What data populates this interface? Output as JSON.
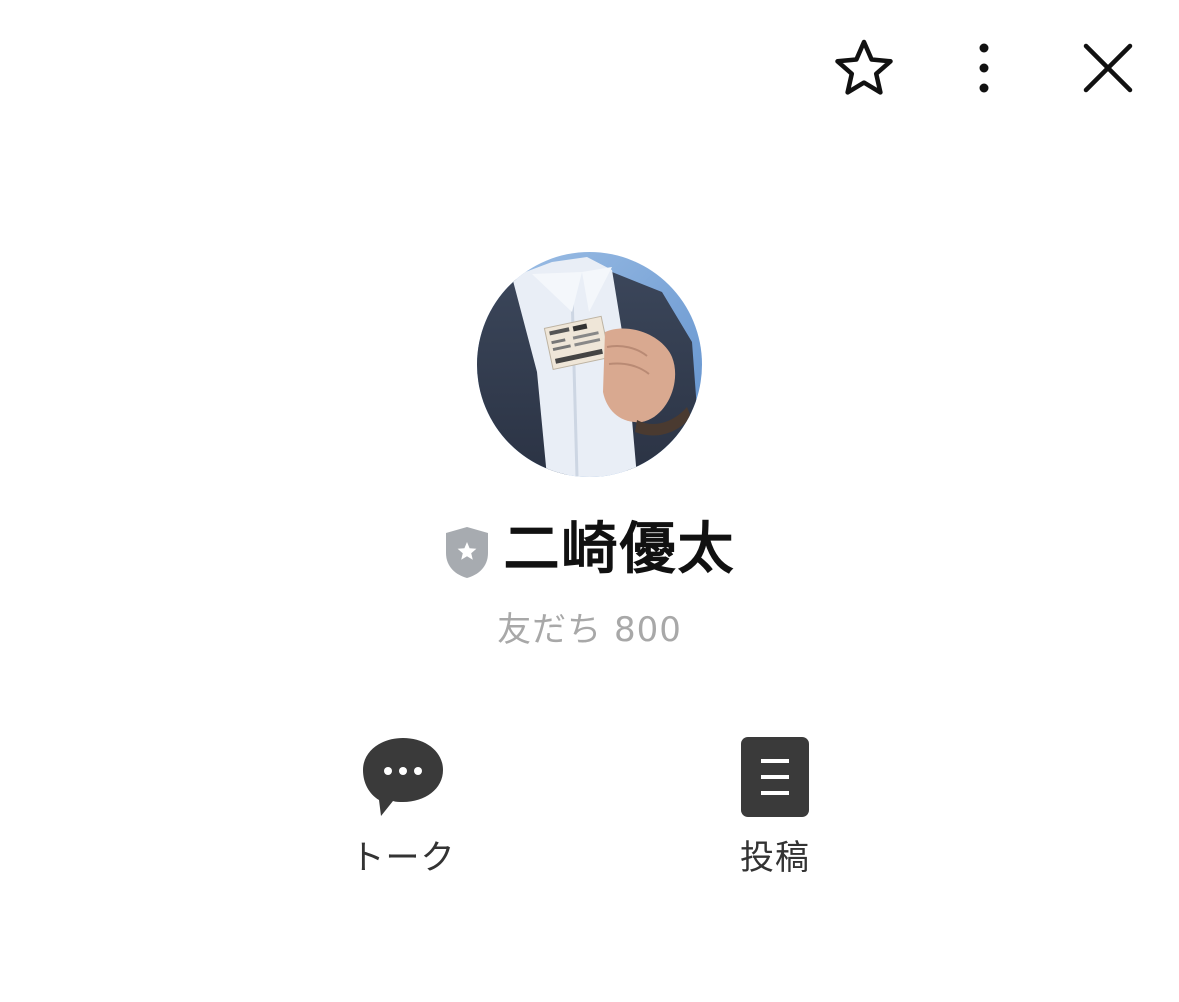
{
  "header": {
    "favorite_icon": "star-outline-icon",
    "more_icon": "vertical-ellipsis-icon",
    "close_icon": "close-x-icon"
  },
  "profile": {
    "avatar": "profile-photo",
    "badge_icon": "official-shield-star-icon",
    "name": "二崎優太",
    "friends_label": "友だち 800"
  },
  "actions": [
    {
      "icon": "chat-bubble-icon",
      "label": "トーク"
    },
    {
      "icon": "post-document-icon",
      "label": "投稿"
    }
  ],
  "colors": {
    "icon": "#111111",
    "action_icon": "#3a3a3a",
    "badge": "#a7abb0",
    "subtext": "#a8a8a8"
  }
}
